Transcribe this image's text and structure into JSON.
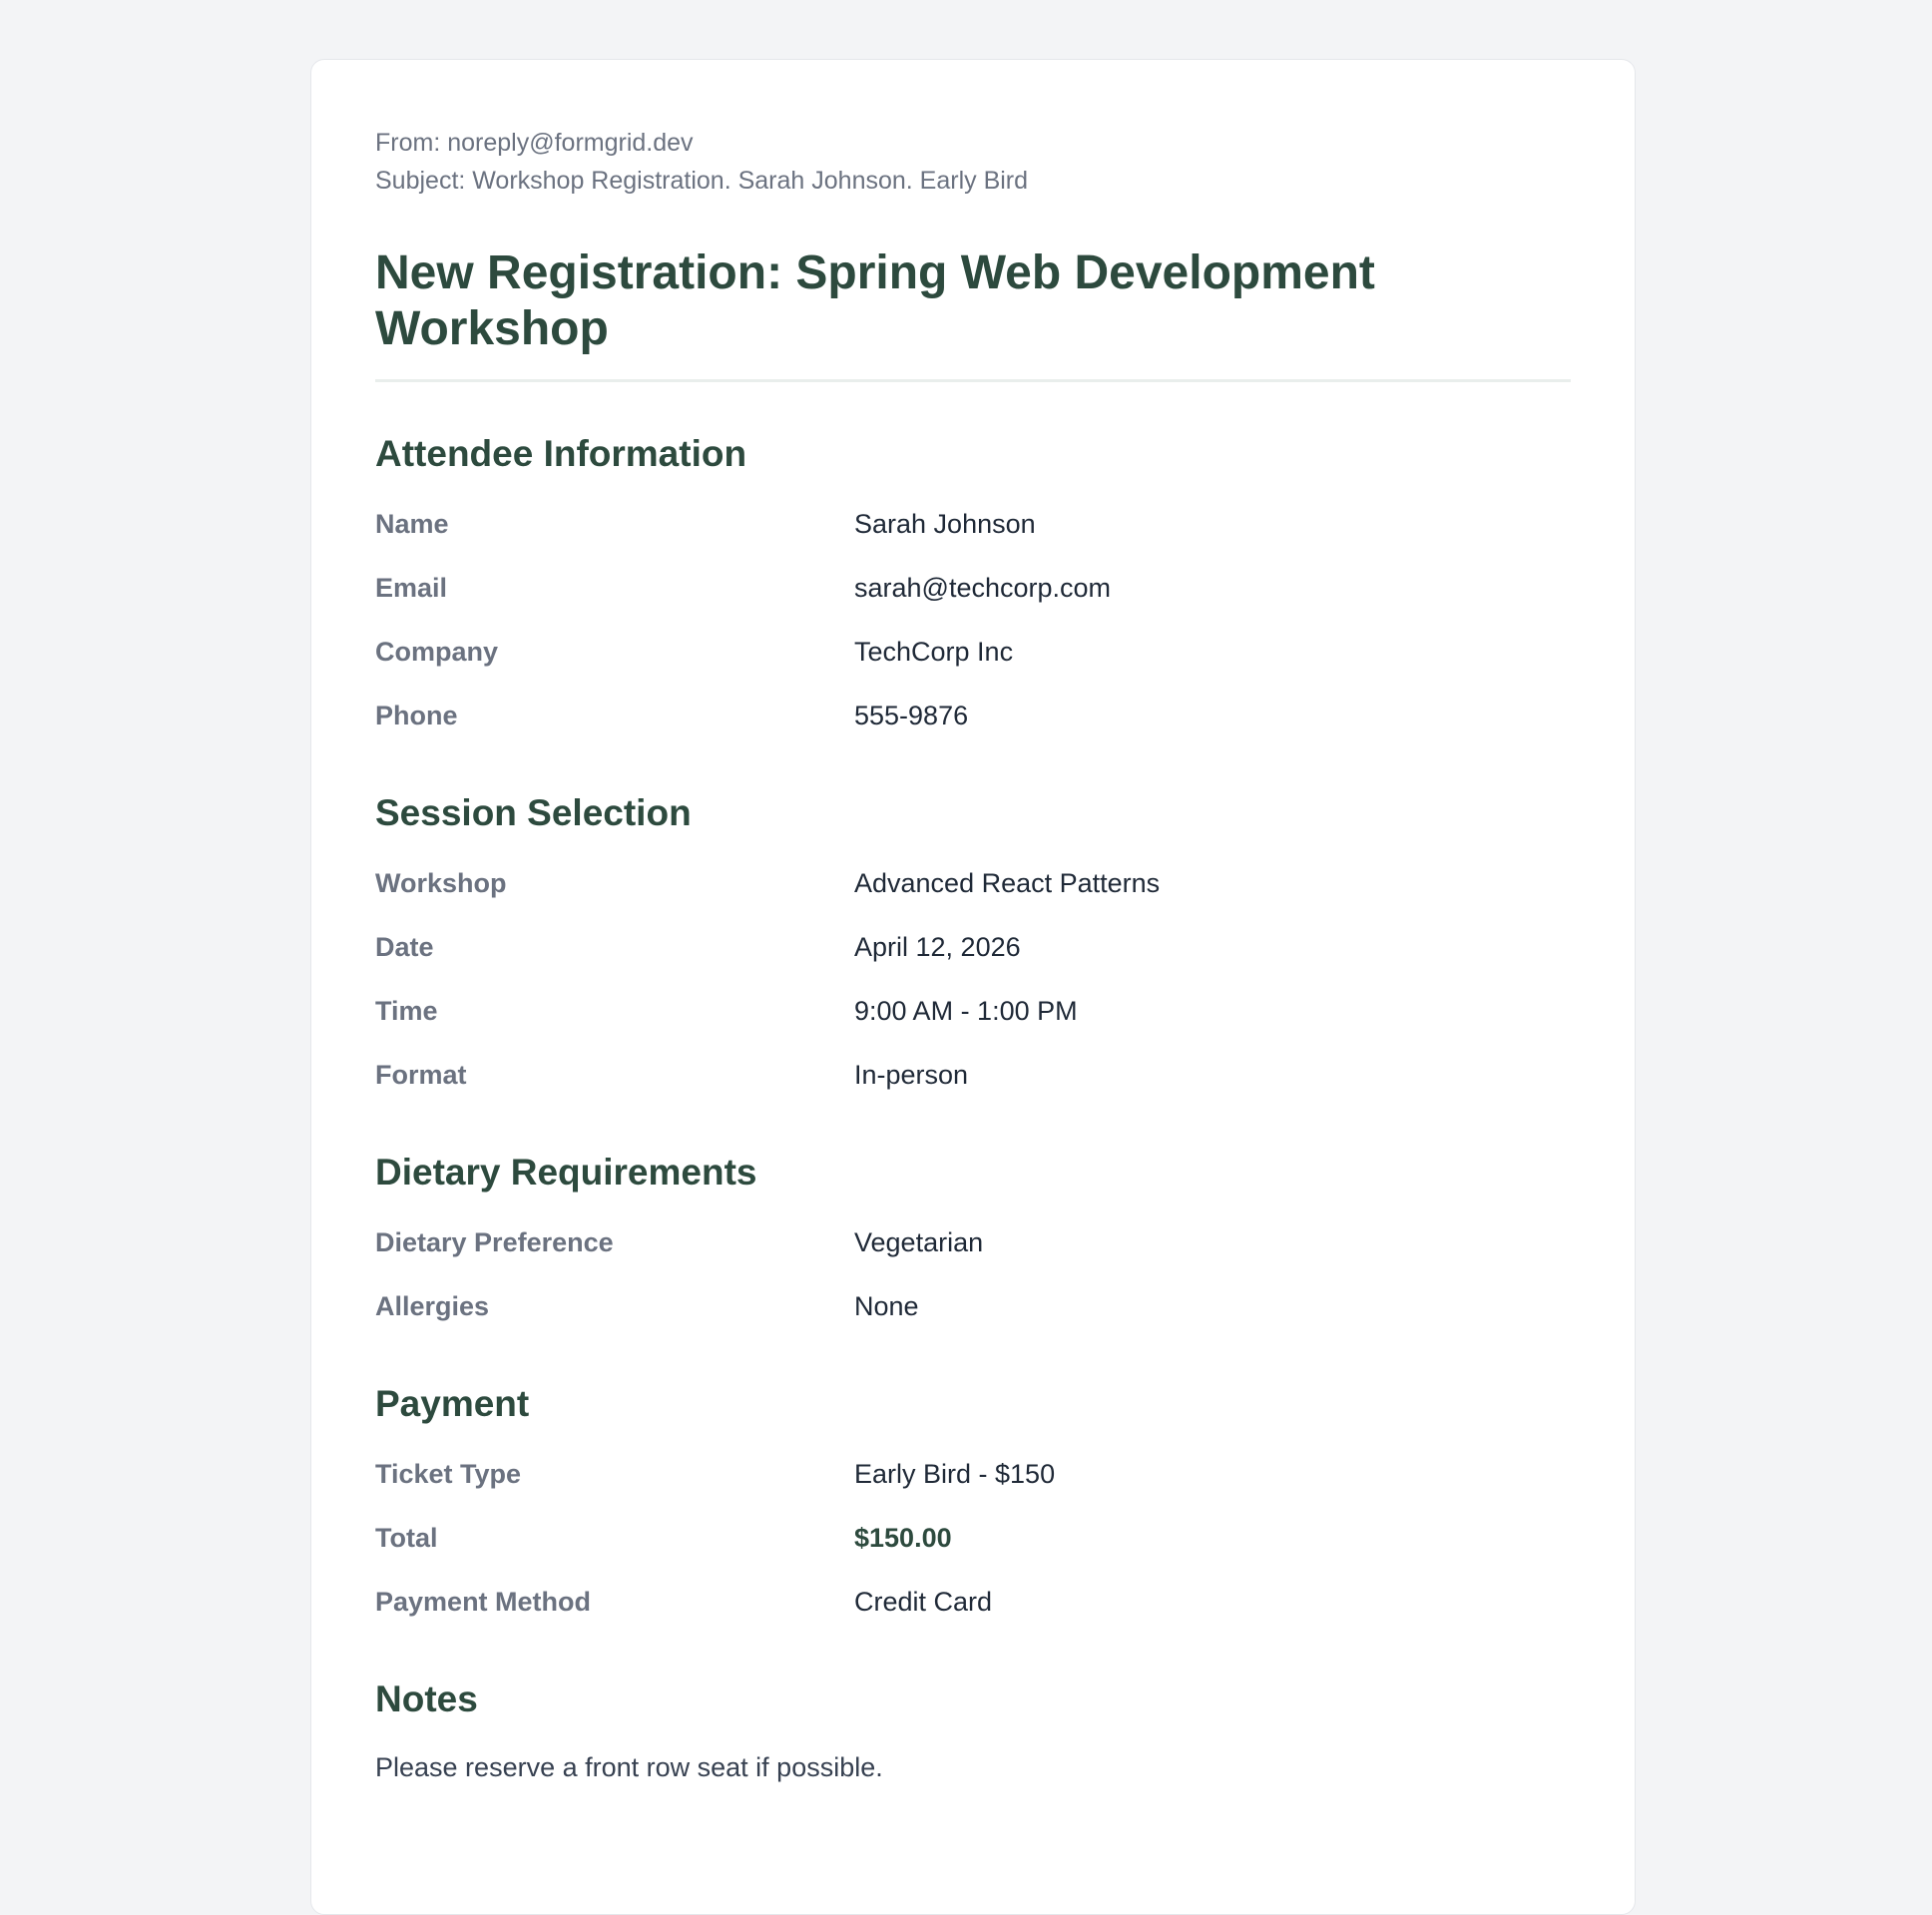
{
  "email": {
    "from": "From: noreply@formgrid.dev",
    "subject": "Subject: Workshop Registration. Sarah Johnson. Early Bird"
  },
  "title": "New Registration: Spring Web Development Workshop",
  "sections": {
    "attendee": {
      "heading": "Attendee Information",
      "rows": [
        {
          "label": "Name",
          "value": "Sarah Johnson"
        },
        {
          "label": "Email",
          "value": "sarah@techcorp.com"
        },
        {
          "label": "Company",
          "value": "TechCorp Inc"
        },
        {
          "label": "Phone",
          "value": "555-9876"
        }
      ]
    },
    "session": {
      "heading": "Session Selection",
      "rows": [
        {
          "label": "Workshop",
          "value": "Advanced React Patterns"
        },
        {
          "label": "Date",
          "value": "April 12, 2026"
        },
        {
          "label": "Time",
          "value": "9:00 AM - 1:00 PM"
        },
        {
          "label": "Format",
          "value": "In-person"
        }
      ]
    },
    "dietary": {
      "heading": "Dietary Requirements",
      "rows": [
        {
          "label": "Dietary Preference",
          "value": "Vegetarian"
        },
        {
          "label": "Allergies",
          "value": "None"
        }
      ]
    },
    "payment": {
      "heading": "Payment",
      "rows": [
        {
          "label": "Ticket Type",
          "value": "Early Bird - $150"
        },
        {
          "label": "Total",
          "value": "$150.00"
        },
        {
          "label": "Payment Method",
          "value": "Credit Card"
        }
      ]
    },
    "notes": {
      "heading": "Notes",
      "text": "Please reserve a front row seat if possible."
    }
  },
  "colors": {
    "background": "#f3f4f6",
    "card": "#ffffff",
    "heading": "#2d4a3e",
    "label": "#6b7280",
    "text": "#1f2937"
  }
}
